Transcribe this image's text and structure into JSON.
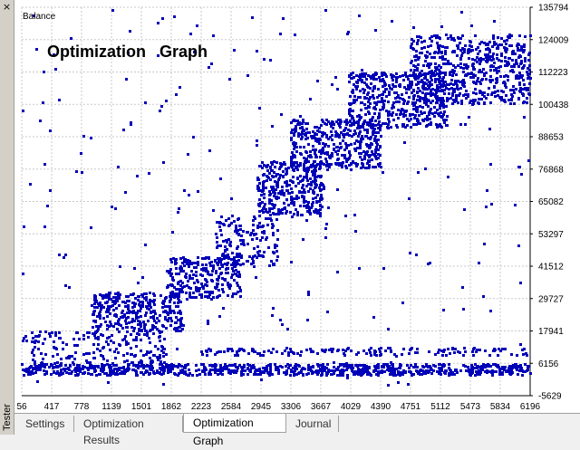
{
  "sidebar": {
    "close_glyph": "×",
    "label": "Tester"
  },
  "chart": {
    "panel_label": "Balance",
    "overlay_title": "Optimization   Graph",
    "colors": {
      "points": "#0000b8",
      "grid": "#c8c8c8",
      "axis": "#000000"
    }
  },
  "chart_data": {
    "type": "scatter",
    "title": "Optimization   Graph",
    "ylabel": "Balance",
    "xlim": [
      56,
      6196
    ],
    "ylim": [
      -5629,
      135794
    ],
    "x_ticks": [
      "56",
      "417",
      "778",
      "1139",
      "1501",
      "1862",
      "2223",
      "2584",
      "2945",
      "3306",
      "3667",
      "4029",
      "4390",
      "4751",
      "5112",
      "5473",
      "5834",
      "6196"
    ],
    "y_ticks": [
      "135794",
      "124009",
      "112223",
      "100438",
      "88653",
      "76868",
      "65082",
      "53297",
      "41512",
      "29727",
      "17941",
      "6156",
      "-5629"
    ],
    "grid": true,
    "series": [
      {
        "color": "#0000b8",
        "regions": [
          {
            "x": [
              56,
              6196
            ],
            "y": [
              2000,
              6000
            ],
            "n": 900
          },
          {
            "x": [
              2223,
              6196
            ],
            "y": [
              9000,
              12000
            ],
            "n": 160
          },
          {
            "x": [
              56,
              1800
            ],
            "y": [
              5000,
              17941
            ],
            "n": 200
          },
          {
            "x": [
              900,
              2000
            ],
            "y": [
              17941,
              32000
            ],
            "n": 320
          },
          {
            "x": [
              1800,
              2700
            ],
            "y": [
              29727,
              45000
            ],
            "n": 260
          },
          {
            "x": [
              2400,
              3150
            ],
            "y": [
              41512,
              60000
            ],
            "n": 160
          },
          {
            "x": [
              2900,
              3700
            ],
            "y": [
              60000,
              80000
            ],
            "n": 320
          },
          {
            "x": [
              3300,
              4400
            ],
            "y": [
              76868,
              95000
            ],
            "n": 420
          },
          {
            "x": [
              4000,
              5200
            ],
            "y": [
              92000,
              112223
            ],
            "n": 460
          },
          {
            "x": [
              4750,
              6196
            ],
            "y": [
              100438,
              126000
            ],
            "n": 620
          },
          {
            "x": [
              56,
              6196
            ],
            "y": [
              -2000,
              135000
            ],
            "n": 240
          }
        ]
      }
    ]
  },
  "tabs": [
    {
      "label": "Settings",
      "active": false
    },
    {
      "label": "Optimization Results",
      "active": false
    },
    {
      "label": "Optimization Graph",
      "active": true
    },
    {
      "label": "Journal",
      "active": false
    }
  ]
}
